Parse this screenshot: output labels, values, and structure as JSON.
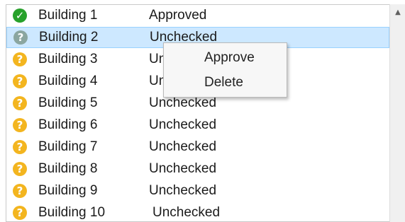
{
  "list": {
    "rows": [
      {
        "name": "Building 1",
        "status": "Approved",
        "icon": "check-icon"
      },
      {
        "name": "Building 2",
        "status": "Unchecked",
        "icon": "question-icon"
      },
      {
        "name": "Building 3",
        "status": "Unchecked",
        "icon": "question-icon"
      },
      {
        "name": "Building 4",
        "status": "Unchecked",
        "icon": "question-icon"
      },
      {
        "name": "Building 5",
        "status": "Unchecked",
        "icon": "question-icon"
      },
      {
        "name": "Building 6",
        "status": "Unchecked",
        "icon": "question-icon"
      },
      {
        "name": "Building 7",
        "status": "Unchecked",
        "icon": "question-icon"
      },
      {
        "name": "Building 8",
        "status": "Unchecked",
        "icon": "question-icon"
      },
      {
        "name": "Building 9",
        "status": "Unchecked",
        "icon": "question-icon"
      },
      {
        "name": "Building 10",
        "status": "Unchecked",
        "icon": "question-icon"
      }
    ],
    "selected_row": "Building 2"
  },
  "context_menu": {
    "items": [
      {
        "label": "Approve"
      },
      {
        "label": "Delete"
      }
    ]
  },
  "scrollbar": {
    "up_arrow_icon": "scroll-up-arrow-icon"
  },
  "colors": {
    "approved": "#27a12b",
    "unchecked": "#f3b51f",
    "selection": "#cde8ff"
  }
}
